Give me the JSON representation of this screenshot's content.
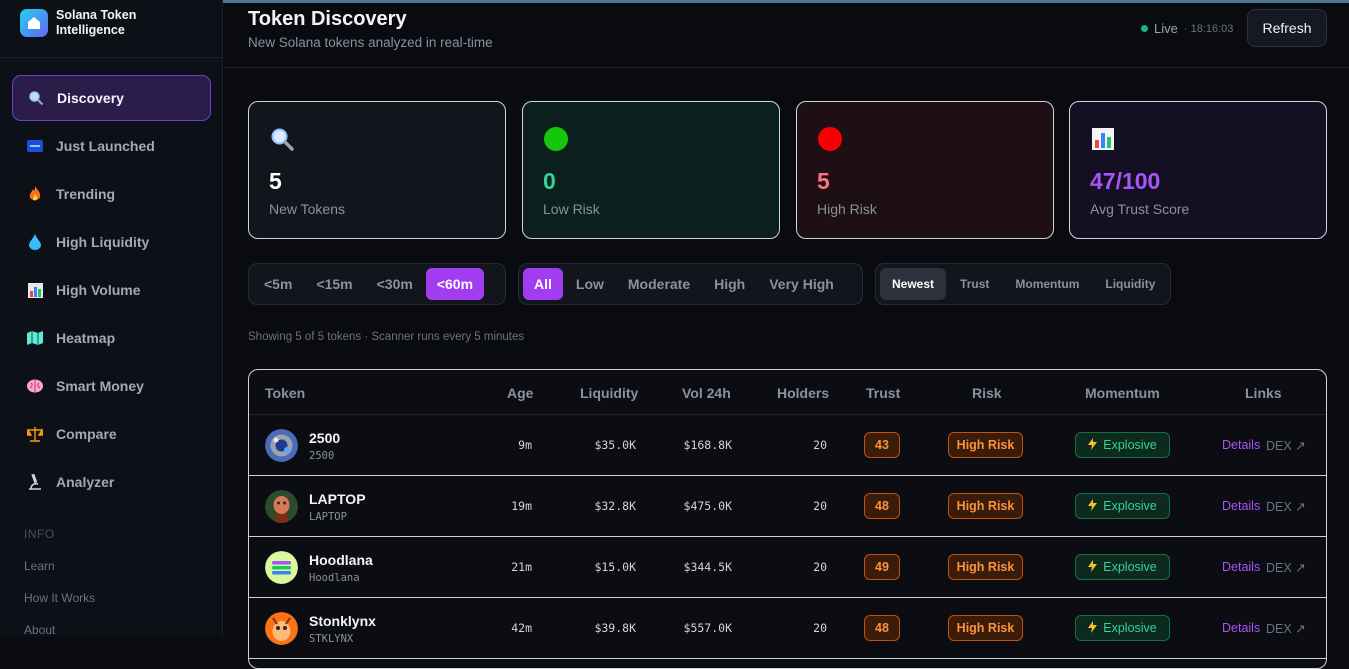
{
  "app": {
    "brand_title": "Solana Token Intelligence"
  },
  "sidebar": {
    "items": [
      {
        "label": "Discovery",
        "icon": "search-icon"
      },
      {
        "label": "Just Launched",
        "icon": "new-badge-icon"
      },
      {
        "label": "Trending",
        "icon": "fire-icon"
      },
      {
        "label": "High Liquidity",
        "icon": "droplet-icon"
      },
      {
        "label": "High Volume",
        "icon": "bar-chart-icon"
      },
      {
        "label": "Heatmap",
        "icon": "map-icon"
      },
      {
        "label": "Smart Money",
        "icon": "brain-icon"
      },
      {
        "label": "Compare",
        "icon": "scales-icon"
      },
      {
        "label": "Analyzer",
        "icon": "microscope-icon"
      }
    ],
    "info_title": "INFO",
    "info_links": [
      "Learn",
      "How It Works",
      "About"
    ]
  },
  "header": {
    "title": "Token Discovery",
    "subtitle": "New Solana tokens analyzed in real-time",
    "live_label": "Live",
    "live_time": "· 18:16:03",
    "refresh_label": "Refresh"
  },
  "stats": [
    {
      "value": "5",
      "label": "New Tokens",
      "icon": "search-icon",
      "color": "#ffffff"
    },
    {
      "value": "0",
      "label": "Low Risk",
      "icon": "green-circle-icon",
      "color": "#34d399"
    },
    {
      "value": "5",
      "label": "High Risk",
      "icon": "red-circle-icon",
      "color": "#fb7185"
    },
    {
      "value": "47/100",
      "label": "Avg Trust Score",
      "icon": "bar-chart-icon",
      "color": "#a855f7"
    }
  ],
  "filters": {
    "age": {
      "options": [
        "<5m",
        "<15m",
        "<30m",
        "<60m"
      ],
      "selected": "<60m"
    },
    "risk": {
      "options": [
        "All",
        "Low",
        "Moderate",
        "High",
        "Very High"
      ],
      "selected": "All"
    },
    "sort": {
      "options": [
        "Newest",
        "Trust",
        "Momentum",
        "Liquidity"
      ],
      "selected": "Newest"
    }
  },
  "showing_text": "Showing 5 of 5 tokens · Scanner runs every 5 minutes",
  "table": {
    "columns": [
      "Token",
      "Age",
      "Liquidity",
      "Vol 24h",
      "Holders",
      "Trust",
      "Risk",
      "Momentum",
      "Links"
    ],
    "rows": [
      {
        "name": "2500",
        "symbol": "2500",
        "age": "9m",
        "liquidity": "$35.0K",
        "volume": "$168.8K",
        "holders": "20",
        "trust": "43",
        "risk": "High Risk",
        "momentum": "Explosive",
        "details": "Details",
        "dex": "DEX ↗"
      },
      {
        "name": "LAPTOP",
        "symbol": "LAPTOP",
        "age": "19m",
        "liquidity": "$32.8K",
        "volume": "$475.0K",
        "holders": "20",
        "trust": "48",
        "risk": "High Risk",
        "momentum": "Explosive",
        "details": "Details",
        "dex": "DEX ↗"
      },
      {
        "name": "Hoodlana",
        "symbol": "Hoodlana",
        "age": "21m",
        "liquidity": "$15.0K",
        "volume": "$344.5K",
        "holders": "20",
        "trust": "49",
        "risk": "High Risk",
        "momentum": "Explosive",
        "details": "Details",
        "dex": "DEX ↗"
      },
      {
        "name": "Stonklynx",
        "symbol": "STKLYNX",
        "age": "42m",
        "liquidity": "$39.8K",
        "volume": "$557.0K",
        "holders": "20",
        "trust": "48",
        "risk": "High Risk",
        "momentum": "Explosive",
        "details": "Details",
        "dex": "DEX ↗"
      }
    ]
  }
}
